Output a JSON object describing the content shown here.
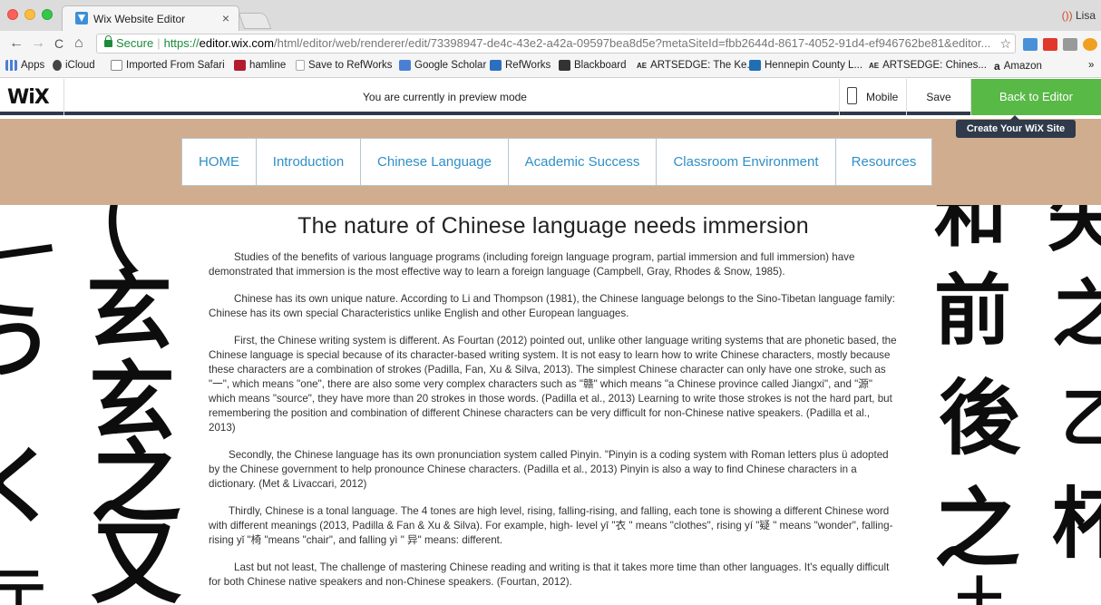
{
  "browser": {
    "tab_title": "Wix Website Editor",
    "tab_close": "×",
    "profile_glyph": "())",
    "profile_name": "Lisa",
    "nav": {
      "back": "←",
      "forward": "→",
      "reload": "C",
      "home": "⌂"
    },
    "secure_label": "Secure",
    "url_scheme": "https://",
    "url_host": "editor.wix.com",
    "url_rest": "/html/editor/web/renderer/edit/73398947-de4c-43e2-a42a-09597bea8d5e?metaSiteId=fbb2644d-8617-4052-91d4-ef946762be81&editor...",
    "star": "☆",
    "bookmarks": [
      {
        "label": "Apps",
        "icon": "apps-grid-icon",
        "color": "#4a7fd4"
      },
      {
        "label": "iCloud",
        "icon": "apple-icon",
        "color": "#444444"
      },
      {
        "label": "Imported From Safari",
        "icon": "folder-icon",
        "color": "#9a9a9a"
      },
      {
        "label": "hamline",
        "icon": "hamline-icon",
        "color": "#b31b2f"
      },
      {
        "label": "Save to RefWorks",
        "icon": "page-icon",
        "color": "#bbbbbb"
      },
      {
        "label": "Google Scholar",
        "icon": "scholar-icon",
        "color": "#4a7fd4"
      },
      {
        "label": "RefWorks",
        "icon": "refworks-icon",
        "color": "#2c6fbf"
      },
      {
        "label": "Blackboard",
        "icon": "blackboard-icon",
        "color": "#333333"
      },
      {
        "label": "ARTSEDGE: The Ke...",
        "icon": "artsedge-icon",
        "color": "#222222"
      },
      {
        "label": "Hennepin County L...",
        "icon": "hennepin-icon",
        "color": "#1f6fb2"
      },
      {
        "label": "ARTSEDGE: Chines...",
        "icon": "artsedge-icon",
        "color": "#222222"
      },
      {
        "label": "Amazon",
        "icon": "amazon-icon",
        "color": "#222222"
      }
    ],
    "bookmarks_overflow": "»"
  },
  "wix_bar": {
    "logo": "WiX",
    "preview_message": "You are currently in preview mode",
    "mobile_label": "Mobile",
    "save_label": "Save",
    "back_label": "Back to Editor",
    "tooltip": "Create Your WiX Site",
    "accent_color": "#59b947"
  },
  "site": {
    "nav_items": [
      "HOME",
      "Introduction",
      "Chinese Language",
      "Academic Success",
      "Classroom Environment",
      "Resources"
    ],
    "header_color": "#d1ad8f",
    "link_color": "#2f8fc7",
    "title": "The nature of Chinese language needs immersion",
    "paragraphs": [
      "Studies of the benefits of various language programs (including foreign language program, partial immersion and full immersion) have demonstrated that immersion is the most effective way to learn a foreign language (Campbell, Gray, Rhodes & Snow, 1985).",
      "Chinese has its own unique nature. According to Li and  Thompson (1981), the Chinese language belongs to the Sino-Tibetan language family: Chinese has its own special Characteristics unlike English and other European languages.",
      "First, the Chinese writing system is different. As Fourtan (2012) pointed out, unlike other language writing systems that are phonetic based, the Chinese language is special because of its character-based writing system. It is not easy to learn how to write Chinese characters, mostly because these characters are a combination of strokes (Padilla, Fan, Xu & Silva, 2013). The simplest Chinese character can only have one stroke, such as \"一\", which means \"one\", there are also some very complex characters such as \"赣\" which means \"a Chinese province called Jiangxi\", and \"源\" which means \"source\", they have more than 20 strokes in those words.  (Padilla et al., 2013) Learning to write those strokes is not the hard part, but remembering the position and combination of different Chinese characters can be very difficult for non-Chinese native speakers. (Padilla et al., 2013)",
      "Secondly, the Chinese language has its own pronunciation system called Pinyin. \"Pinyin is a coding system with Roman letters plus ü adopted by the Chinese government to help pronounce Chinese characters. (Padilla et al., 2013) Pinyin is also a way to find Chinese characters in a dictionary. (Met & Livaccari, 2012)",
      "Thirdly, Chinese is a tonal language. The 4 tones are high level, rising, falling-rising, and falling, each tone is showing a different Chinese word with different meanings (2013, Padilla & Fan & Xu & Silva). For example, high- level yī \"衣 \" means  \"clothes\", rising yí \"疑 \" means \"wonder\", falling-rising yǐ \"椅 \"means \"chair\", and falling yì \" 异\" means: different.",
      "Last but not least, The challenge of mastering Chinese reading and writing is that it takes more time than other languages. It's equally difficult for both Chinese native speakers and non-Chinese speakers. (Fourtan, 2012)."
    ],
    "calligraphy_glyphs": [
      "玄",
      "玄",
      "之",
      "又",
      "和",
      "前",
      "後",
      "之",
      "矢",
      "之",
      "杯"
    ]
  }
}
